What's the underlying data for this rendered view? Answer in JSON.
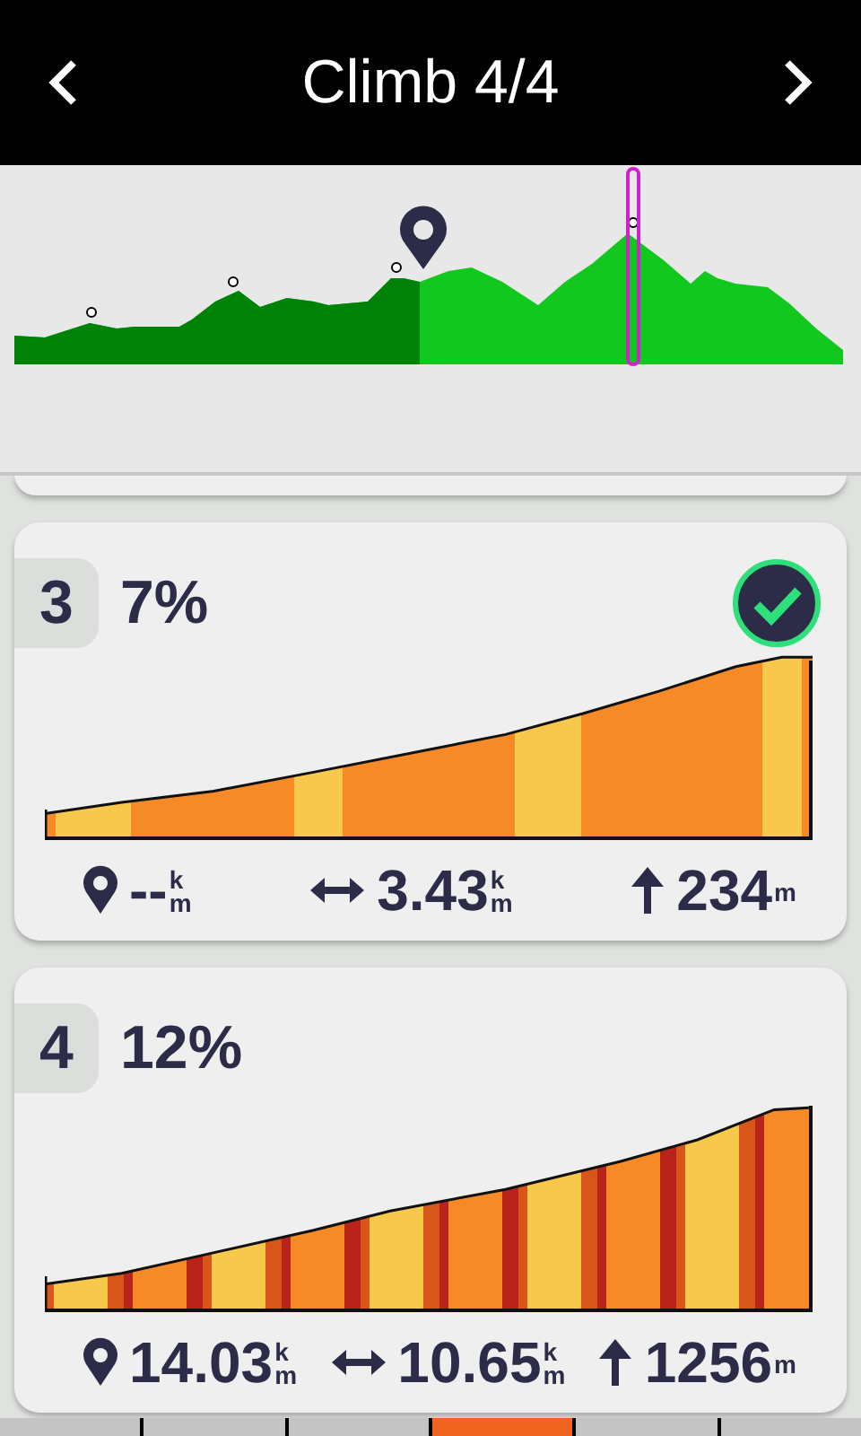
{
  "header": {
    "title": "Climb 4/4"
  },
  "climbs": [
    {
      "kind": "partial"
    },
    {
      "number": "3",
      "grade": "7%",
      "completed": true,
      "kind": "moderate",
      "distance": "--",
      "distance_unit": [
        "k",
        "m"
      ],
      "length": "3.43",
      "length_unit": [
        "k",
        "m"
      ],
      "gain": "234",
      "gain_unit": [
        "m"
      ]
    },
    {
      "number": "4",
      "grade": "12%",
      "completed": false,
      "kind": "steep",
      "distance": "14.03",
      "distance_unit": [
        "k",
        "m"
      ],
      "length": "10.65",
      "length_unit": [
        "k",
        "m"
      ],
      "gain": "1256",
      "gain_unit": [
        "m"
      ]
    }
  ],
  "pages": [
    {
      "selected": false
    },
    {
      "selected": false
    },
    {
      "selected": false
    },
    {
      "selected": true
    },
    {
      "selected": false
    },
    {
      "selected": false
    }
  ]
}
